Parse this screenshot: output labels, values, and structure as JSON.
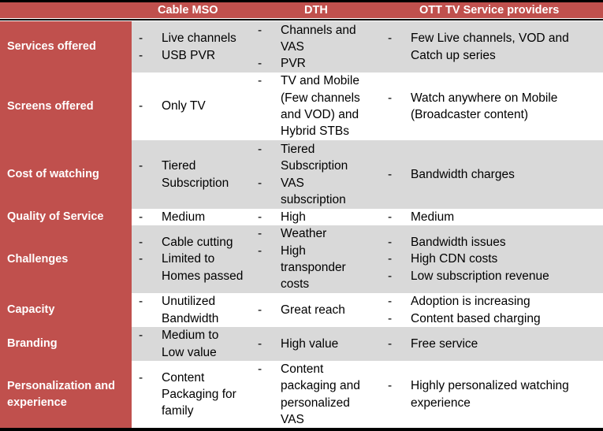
{
  "colors": {
    "header_bg": "#C0504D",
    "row_label_bg": "#C0504D",
    "row_alt_bg": "#D9D9D9",
    "row_bg": "#FFFFFF",
    "border": "#000000"
  },
  "table": {
    "columns": [
      "",
      "Cable MSO",
      "DTH",
      "OTT TV Service providers"
    ],
    "bullet": "-",
    "rows": [
      {
        "label": "Services offered",
        "cable": [
          [
            "Live channels"
          ],
          [
            "USB PVR"
          ]
        ],
        "dth": [
          [
            "Channels and",
            "VAS"
          ],
          [
            "PVR"
          ]
        ],
        "ott": [
          [
            "Few Live channels, VOD and",
            "Catch up series"
          ]
        ]
      },
      {
        "label": "Screens offered",
        "cable": [
          [
            "Only TV"
          ]
        ],
        "dth": [
          [
            "TV and Mobile",
            "(Few channels",
            "and VOD) and",
            "Hybrid STBs"
          ]
        ],
        "ott": [
          [
            "Watch anywhere on Mobile",
            "(Broadcaster content)"
          ]
        ]
      },
      {
        "label": "Cost of watching",
        "cable": [
          [
            "Tiered",
            "Subscription"
          ]
        ],
        "dth": [
          [
            "Tiered",
            "Subscription"
          ],
          [
            "VAS",
            "subscription"
          ]
        ],
        "ott": [
          [
            "Bandwidth charges"
          ]
        ]
      },
      {
        "label": "Quality of Service",
        "cable": [
          [
            "Medium"
          ]
        ],
        "dth": [
          [
            "High"
          ]
        ],
        "ott": [
          [
            "Medium"
          ]
        ]
      },
      {
        "label": "Challenges",
        "cable": [
          [
            "Cable cutting"
          ],
          [
            "Limited to",
            "Homes passed"
          ]
        ],
        "dth": [
          [
            "Weather"
          ],
          [
            "High",
            "transponder",
            "costs"
          ]
        ],
        "ott": [
          [
            "Bandwidth issues"
          ],
          [
            "High CDN costs"
          ],
          [
            "Low subscription revenue"
          ]
        ]
      },
      {
        "label": "Capacity",
        "cable": [
          [
            "Unutilized",
            "Bandwidth"
          ]
        ],
        "dth": [
          [
            "Great reach"
          ]
        ],
        "ott": [
          [
            "Adoption is increasing"
          ],
          [
            "Content based charging"
          ]
        ]
      },
      {
        "label": "Branding",
        "cable": [
          [
            "Medium to",
            "Low value"
          ]
        ],
        "dth": [
          [
            "High value"
          ]
        ],
        "ott": [
          [
            "Free service"
          ]
        ]
      },
      {
        "label": "Personalization and experience",
        "label_lines": [
          "Personalization and",
          "experience"
        ],
        "cable": [
          [
            "Content",
            "Packaging for",
            "family"
          ]
        ],
        "dth": [
          [
            "Content",
            "packaging and",
            "personalized",
            "VAS"
          ]
        ],
        "ott": [
          [
            "Highly personalized watching",
            "experience"
          ]
        ]
      }
    ]
  }
}
